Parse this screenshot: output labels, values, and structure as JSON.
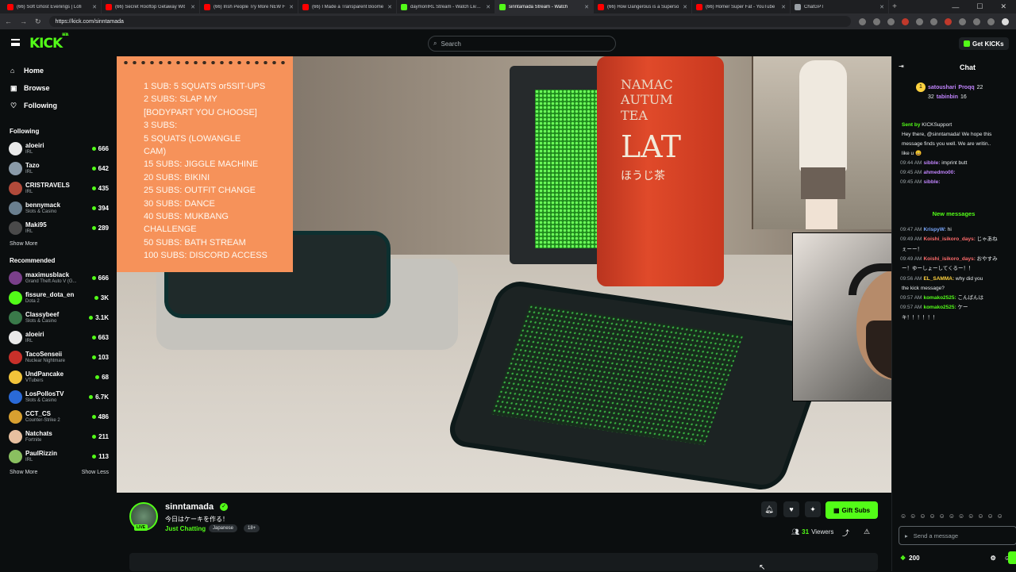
{
  "browser": {
    "tabs": [
      {
        "label": "(66) Soft Ghost Evenings | Lofi",
        "color": "#ff0000"
      },
      {
        "label": "(66) Secret Rooftop Getaway Wit",
        "color": "#ff0000"
      },
      {
        "label": "(66) Irish People Try More NEW F",
        "color": "#ff0000"
      },
      {
        "label": "(66) I Made a Transparent Boome",
        "color": "#ff0000"
      },
      {
        "label": "daymonIRL Stream - Watch Live o",
        "color": "#53fc18"
      },
      {
        "label": "sinntamada Stream - Watch",
        "color": "#53fc18",
        "active": true
      },
      {
        "label": "(66) How Dangerous is a Superso",
        "color": "#ff0000"
      },
      {
        "label": "(66) Homer Super Fat - YouTube",
        "color": "#ff0000"
      },
      {
        "label": "ChatGPT",
        "color": "#9aa0a6"
      }
    ],
    "url": "https://kick.com/sinntamada"
  },
  "header": {
    "logo": "KICK",
    "logo_sup": "BETA",
    "search_placeholder": "Search",
    "get_kicks": "Get KICKs"
  },
  "sidebar": {
    "nav": [
      {
        "label": "Home",
        "icon": "home-icon",
        "glyph": "⌂"
      },
      {
        "label": "Browse",
        "icon": "browse-icon",
        "glyph": "▣"
      },
      {
        "label": "Following",
        "icon": "heart-icon",
        "glyph": "♡"
      }
    ],
    "following_title": "Following",
    "following": [
      {
        "name": "aloeiri",
        "category": "IRL",
        "viewers": "666",
        "color": "#e9e9e9"
      },
      {
        "name": "Tazo",
        "category": "IRL",
        "viewers": "642",
        "color": "#8a9aa8"
      },
      {
        "name": "CRISTRAVELS",
        "category": "IRL",
        "viewers": "435",
        "color": "#b14a3a"
      },
      {
        "name": "bennymack",
        "category": "Slots & Casino",
        "viewers": "394",
        "color": "#6a7f8f"
      },
      {
        "name": "Maki95",
        "category": "IRL",
        "viewers": "289",
        "color": "#4a4a4a"
      }
    ],
    "show_more_1": "Show More",
    "recommended_title": "Recommended",
    "recommended": [
      {
        "name": "maximusblack",
        "category": "Grand Theft Auto V (G...",
        "viewers": "666",
        "color": "#7a3f8a"
      },
      {
        "name": "fissure_dota_en",
        "category": "Dota 2",
        "viewers": "3K",
        "color": "#53fc18"
      },
      {
        "name": "Classybeef",
        "category": "Slots & Casino",
        "viewers": "3.1K",
        "color": "#3a7a4a"
      },
      {
        "name": "aloeiri",
        "category": "IRL",
        "viewers": "663",
        "color": "#e9e9e9"
      },
      {
        "name": "TacoSenseii",
        "category": "Nuclear Nightmare",
        "viewers": "103",
        "color": "#c8302a"
      },
      {
        "name": "UndPancake",
        "category": "VTubers",
        "viewers": "68",
        "color": "#f2c43a"
      },
      {
        "name": "LosPollosTV",
        "category": "Slots & Casino",
        "viewers": "6.7K",
        "color": "#2a6ad8"
      },
      {
        "name": "CCT_CS",
        "category": "Counter-Strike 2",
        "viewers": "486",
        "color": "#d8a030"
      },
      {
        "name": "Natchats",
        "category": "Fortnite",
        "viewers": "211",
        "color": "#e8c0a0"
      },
      {
        "name": "PaulRizzin",
        "category": "IRL",
        "viewers": "113",
        "color": "#8ac060"
      }
    ],
    "show_more_2": "Show More",
    "show_less": "Show Less"
  },
  "video": {
    "rules": [
      "1 SUB: 5 SQUATS or5SIT-UPS",
      "2 SUBS: SLAP MY",
      "[BODYPART YOU CHOOSE]",
      "3 SUBS:",
      "5    SQUATS    (LOWANGLE",
      "CAM)",
      "15 SUBS: JIGGLE MACHINE",
      "20 SUBS: BIKINI",
      "25 SUBS: OUTFIT CHANGE",
      "30 SUBS: DANCE",
      "40 SUBS: MUKBANG",
      "CHALLENGE",
      "50 SUBS: BATH STREAM",
      "100 SUBS: DISCORD ACCESS"
    ],
    "can_text": [
      "NAMAC",
      "AUTUM",
      "TEA",
      "LAT",
      "ほうじ茶"
    ]
  },
  "channel": {
    "name": "sinntamada",
    "live": "LIVE",
    "title": "今日はケーキを作る！",
    "category": "Just Chatting",
    "tags": [
      "Japanese",
      "18+"
    ],
    "viewers_count": "31",
    "viewers_label": "Viewers",
    "gift_subs": "Gift Subs"
  },
  "chat": {
    "title": "Chat",
    "pinned": [
      {
        "user": "satoushari",
        "count": "32",
        "other": "Proqq",
        "other_count": "22"
      },
      {
        "user": "",
        "count": "",
        "other": "tabinbin",
        "other_count": "16"
      }
    ],
    "messages": [
      {
        "time": "",
        "user": "Sent by",
        "text": "KICKSupport",
        "cls": "u-green"
      },
      {
        "time": "",
        "user": "",
        "text": "Hey there, @sinntamada! We hope this",
        "cls": ""
      },
      {
        "time": "",
        "user": "",
        "text": "message finds you well. We are writin..",
        "cls": ""
      },
      {
        "time": "",
        "user": "",
        "text": "like u 😀",
        "cls": ""
      },
      {
        "time": "09:44 AM",
        "user": "sibble:",
        "text": "imprint butt",
        "cls": "u-purple"
      },
      {
        "time": "09:45 AM",
        "user": "ahmedmo00:",
        "text": "",
        "cls": "u-purple"
      },
      {
        "time": "09:45 AM",
        "user": "sibble:",
        "text": "",
        "cls": "u-purple"
      }
    ],
    "new_messages": "New messages",
    "messages2": [
      {
        "time": "09:47 AM",
        "user": "KrispyW:",
        "text": "hi",
        "cls": "u-blue"
      },
      {
        "time": "09:49 AM",
        "user": "Koishi_isikoro_days:",
        "text": "じゃあね",
        "cls": "u-red"
      },
      {
        "time": "",
        "user": "",
        "text": "ぇーー！",
        "cls": ""
      },
      {
        "time": "09:49 AM",
        "user": "Koishi_isikoro_days:",
        "text": "おやすみ",
        "cls": "u-red"
      },
      {
        "time": "",
        "user": "",
        "text": "ー！ゆーしょーしてくるー！！",
        "cls": ""
      },
      {
        "time": "09:56 AM",
        "user": "EL_SAMMA:",
        "text": "why did you",
        "cls": "u-yellow"
      },
      {
        "time": "",
        "user": "",
        "text": "the kick message?",
        "cls": ""
      },
      {
        "time": "09:57 AM",
        "user": "komako2525:",
        "text": "こんばんは",
        "cls": "u-green"
      },
      {
        "time": "09:57 AM",
        "user": "komako2525:",
        "text": "ケー",
        "cls": "u-green"
      },
      {
        "time": "",
        "user": "",
        "text": "キ！！！！！！",
        "cls": ""
      }
    ],
    "input_placeholder": "Send a message",
    "kicks_count": "200"
  }
}
